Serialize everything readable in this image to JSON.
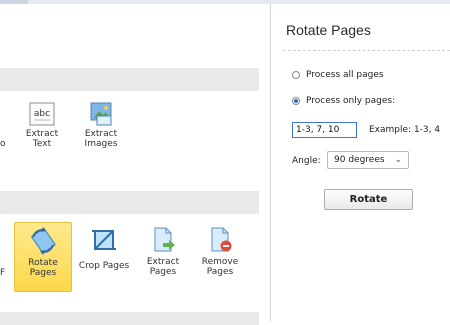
{
  "left": {
    "cut_labels": [
      "o",
      "F"
    ],
    "tools_row1": [
      {
        "label_line1": "Extract",
        "label_line2": "Text",
        "icon": "abc-text-icon"
      },
      {
        "label_line1": "Extract",
        "label_line2": "Images",
        "icon": "image-icon"
      }
    ],
    "tools_row2": [
      {
        "label_line1": "Rotate",
        "label_line2": "Pages",
        "icon": "rotate-icon",
        "selected": true
      },
      {
        "label_line1": "Crop Pages",
        "label_line2": "",
        "icon": "crop-icon"
      },
      {
        "label_line1": "Extract",
        "label_line2": "Pages",
        "icon": "page-arrow-icon"
      },
      {
        "label_line1": "Remove",
        "label_line2": "Pages",
        "icon": "page-remove-icon"
      }
    ],
    "abc_glyph": "abc"
  },
  "panel": {
    "title": "Rotate Pages",
    "options": [
      {
        "label": "Process all pages",
        "checked": false
      },
      {
        "label": "Process only pages:",
        "checked": true
      }
    ],
    "pages_value": "1-3, 7, 10",
    "example": "Example: 1-3, 4",
    "angle_label": "Angle:",
    "angle_value": "90 degrees",
    "rotate_button": "Rotate"
  },
  "colors": {
    "accent": "#2f6fbe",
    "selected_fill": "#fbd84a",
    "section_header": "#e9e9e9"
  }
}
